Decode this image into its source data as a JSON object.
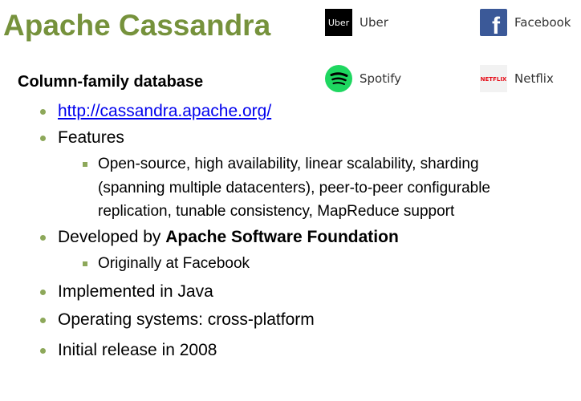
{
  "slide": {
    "title": "Apache Cassandra",
    "subtitle": "Column-family database"
  },
  "logos": [
    {
      "name": "Uber",
      "icon": "uber-logo-icon"
    },
    {
      "name": "Facebook",
      "icon": "facebook-logo-icon"
    },
    {
      "name": "Spotify",
      "icon": "spotify-logo-icon"
    },
    {
      "name": "Netflix",
      "icon": "netflix-logo-icon"
    }
  ],
  "logo_marks": {
    "uber": "Uber",
    "facebook": "f",
    "netflix": "NETFLIX"
  },
  "bullets": {
    "link": "http://cassandra.apache.org/",
    "features_label": "Features",
    "features_sub_lines": [
      "Open-source, high availability, linear scalability, sharding",
      "(spanning multiple datacenters), peer-to-peer configurable",
      "replication, tunable consistency, MapReduce support"
    ],
    "developed_prefix": "Developed by ",
    "developed_org": "Apache Software Foundation",
    "developed_sub": "Originally at Facebook",
    "implemented": "Implemented in Java",
    "os": "Operating systems: cross-platform",
    "release": "Initial release in 2008"
  },
  "colors": {
    "title": "#76923C",
    "bullet": "#8DA85A",
    "link": "#0000EE",
    "facebook": "#3B5998",
    "spotify": "#1ED760",
    "netflix": "#E50914",
    "uber": "#000000"
  }
}
